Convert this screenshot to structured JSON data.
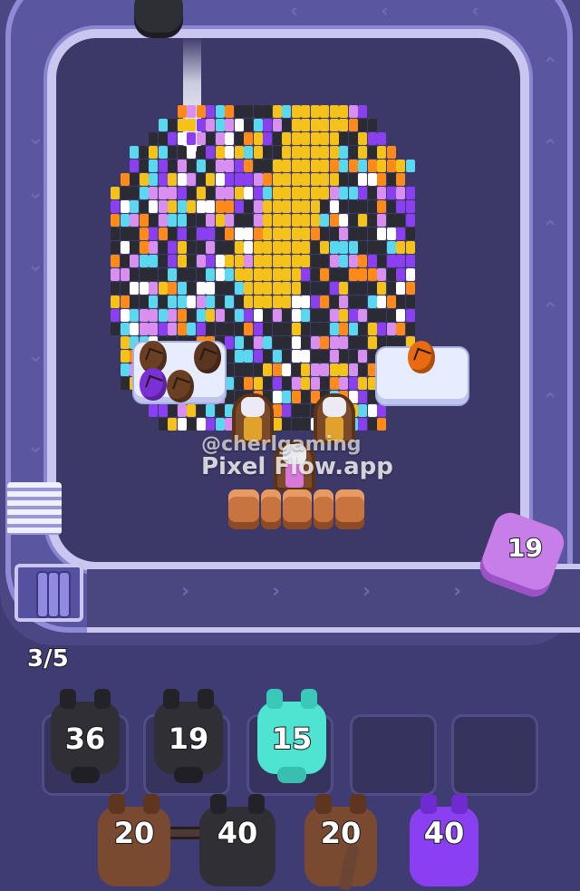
{
  "colors": {
    "background": "#3f3b73",
    "track": "#4b4784",
    "track_edge": "#c9c6ef",
    "black_pig": "#2f2f35",
    "cyan_pig": "#4fe3d2",
    "brown_pig": "#7a4a30",
    "purple_pig": "#8a3ff0",
    "pink_pig": "#c87ee8"
  },
  "watermark": {
    "line1": "@cherlgaming",
    "line2": "Pixel Flow.app"
  },
  "belt_shooter": {
    "count": "19",
    "color": "pink",
    "icon": "pig-shooter-icon"
  },
  "queue_counter": "3/5",
  "slots": [
    {
      "count": "36",
      "color": "black"
    },
    {
      "count": "19",
      "color": "black"
    },
    {
      "count": "15",
      "color": "cyan"
    },
    {
      "count": "",
      "color": "empty"
    },
    {
      "count": "",
      "color": "empty"
    }
  ],
  "reserve": [
    {
      "count": "20",
      "color": "brown"
    },
    {
      "count": "40",
      "color": "black"
    },
    {
      "count": "20",
      "color": "brown"
    },
    {
      "count": "40",
      "color": "purple"
    }
  ]
}
